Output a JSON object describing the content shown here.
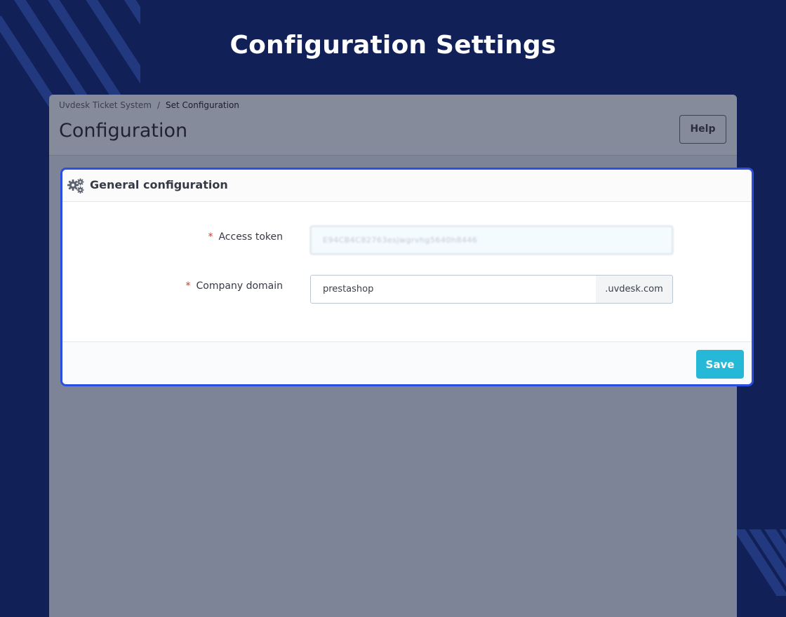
{
  "banner": {
    "title": "Configuration Settings"
  },
  "breadcrumb": {
    "parent": "Uvdesk Ticket System",
    "separator": "/",
    "current": "Set Configuration"
  },
  "header": {
    "title": "Configuration",
    "help_label": "Help"
  },
  "panel": {
    "icon": "cogs-icon",
    "title": "General configuration",
    "required_marker": "*",
    "fields": {
      "access_token": {
        "label": "Access token",
        "value": "E94CB4C82763esjwgrvhg5640h8446"
      },
      "company_domain": {
        "label": "Company domain",
        "value": "prestashop",
        "suffix": ".uvdesk.com"
      }
    },
    "save_label": "Save"
  },
  "colors": {
    "accent": "#25b9d7",
    "focus_border": "#2a4ee0",
    "background": "#112056"
  }
}
